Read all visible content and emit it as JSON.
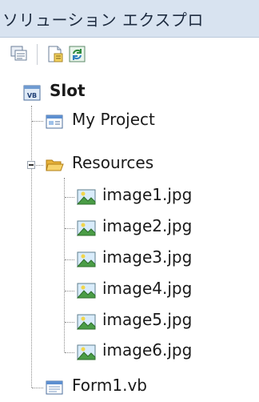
{
  "panel": {
    "title": "ソリューション エクスプロ"
  },
  "toolbar": {
    "buttons": [
      {
        "name": "show-all-files",
        "icon": "show-all-files-icon"
      },
      {
        "name": "properties",
        "icon": "properties-icon"
      },
      {
        "name": "refresh",
        "icon": "refresh-icon"
      }
    ]
  },
  "tree": {
    "root": {
      "label": "Slot",
      "icon": "vb-project-icon"
    },
    "my_project": {
      "label": "My Project",
      "icon": "my-project-icon"
    },
    "resources": {
      "label": "Resources",
      "icon": "folder-open-icon",
      "expanded": true,
      "items": [
        {
          "label": "image1.jpg",
          "icon": "image-file-icon"
        },
        {
          "label": "image2.jpg",
          "icon": "image-file-icon"
        },
        {
          "label": "image3.jpg",
          "icon": "image-file-icon"
        },
        {
          "label": "image4.jpg",
          "icon": "image-file-icon"
        },
        {
          "label": "image5.jpg",
          "icon": "image-file-icon"
        },
        {
          "label": "image6.jpg",
          "icon": "image-file-icon"
        }
      ]
    },
    "form1": {
      "label": "Form1.vb",
      "icon": "vb-form-icon"
    }
  },
  "colors": {
    "title_bar": "#d8e3f0",
    "tree_lines": "#8a8a8a",
    "folder": "#f2c24b"
  }
}
